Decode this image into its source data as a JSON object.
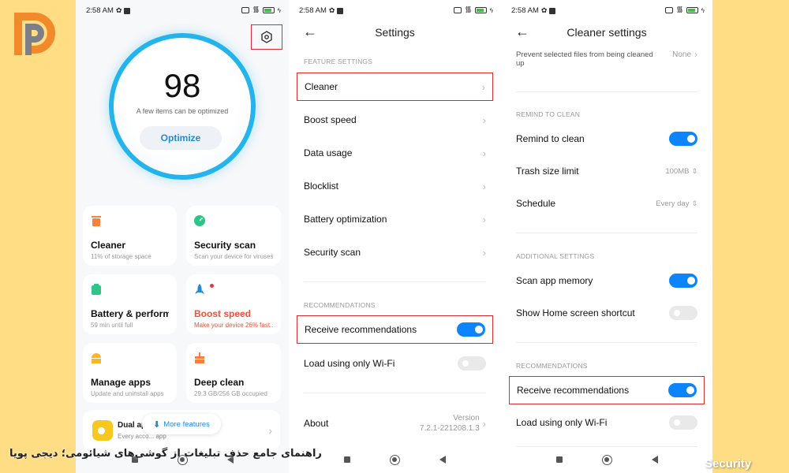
{
  "brand": {
    "logo_icon": "dp-logo-icon",
    "colors": {
      "background": "#fedd84",
      "accent_blue": "#0d84ff",
      "highlight_red": "#d32f2f",
      "ring_blue": "#22b4ea",
      "boost_red": "#e8533a"
    }
  },
  "status_bar": {
    "time": "2:58 AM"
  },
  "phone1": {
    "score": "98",
    "score_subtitle": "A few items can be optimized",
    "optimize_label": "Optimize",
    "cards": [
      {
        "title": "Cleaner",
        "subtitle": "11% of storage space",
        "icon": "trash-icon",
        "color": "#f7813a"
      },
      {
        "title": "Security scan",
        "subtitle": "Scan your device for viruses",
        "icon": "shield-scan-icon",
        "color": "#2fc489"
      },
      {
        "title": "Battery & perform...",
        "subtitle": "59 min  until full",
        "icon": "battery-icon",
        "color": "#2fc489"
      },
      {
        "title": "Boost speed",
        "subtitle": "Make your device 26% fast...",
        "icon": "rocket-icon",
        "color": "#1f8bd8"
      },
      {
        "title": "Manage apps",
        "subtitle": "Update and uninstall apps",
        "icon": "android-icon",
        "color": "#f9b52b"
      },
      {
        "title": "Deep clean",
        "subtitle": "29.3 GB/256 GB occupied",
        "icon": "brush-icon",
        "color": "#f7813a"
      }
    ],
    "dual_apps": {
      "title": "Dual ap",
      "subtitle": "Every acco... app"
    },
    "more_features_label": "More features"
  },
  "phone2": {
    "title": "Settings",
    "section_feature": "FEATURE SETTINGS",
    "items": [
      "Cleaner",
      "Boost speed",
      "Data usage",
      "Blocklist",
      "Battery optimization",
      "Security scan"
    ],
    "section_recommendations": "RECOMMENDATIONS",
    "receive_recommendations": {
      "label": "Receive recommendations",
      "on": true
    },
    "wifi_only": {
      "label": "Load using only Wi-Fi",
      "on": false
    },
    "about": {
      "label": "About",
      "version_label": "Version",
      "version": "7.2.1-221208.1.3"
    }
  },
  "phone3": {
    "title": "Cleaner settings",
    "exceptions": {
      "subtitle": "Prevent selected files from being cleaned up",
      "value": "None"
    },
    "section_remind": "REMIND TO CLEAN",
    "remind": {
      "label": "Remind to clean",
      "on": true
    },
    "trash_limit": {
      "label": "Trash size limit",
      "value": "100MB"
    },
    "schedule": {
      "label": "Schedule",
      "value": "Every day"
    },
    "section_additional": "ADDITIONAL SETTINGS",
    "scan_memory": {
      "label": "Scan app memory",
      "on": true
    },
    "home_shortcut": {
      "label": "Show Home screen shortcut",
      "on": false
    },
    "section_recommendations": "RECOMMENDATIONS",
    "receive_recommendations": {
      "label": "Receive recommendations",
      "on": true
    },
    "wifi_only": {
      "label": "Load using only Wi-Fi",
      "on": false
    }
  },
  "caption": "راهنمای جامع حذف تبلیغات از گوشی‌های شیائومی؛ دیجی پویا",
  "watermark": "Security"
}
